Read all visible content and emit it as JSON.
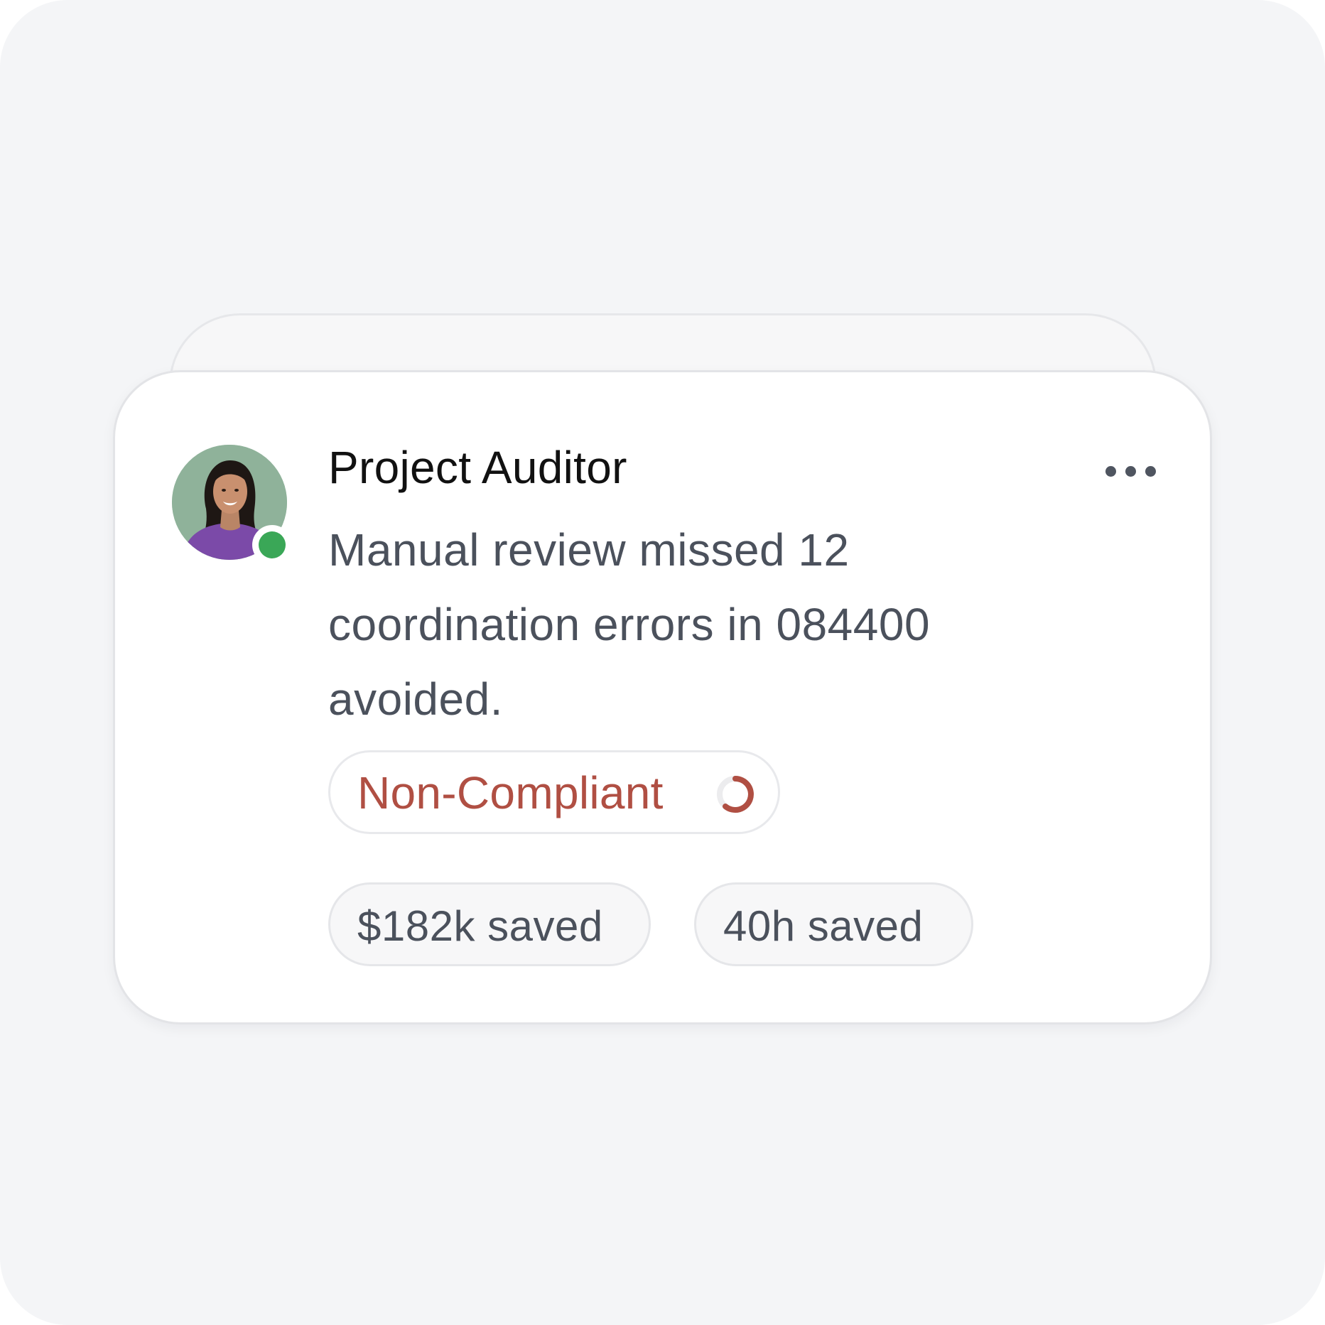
{
  "card": {
    "title": "Project Auditor",
    "message": "Manual review missed 12 coordination errors in 084400 avoided.",
    "avatar": {
      "alt": "avatar",
      "presence": "online"
    },
    "status": {
      "label": "Non-Compliant",
      "color": "#b04f43",
      "icon": "progress-ring-icon"
    },
    "metrics": [
      {
        "label": "$182k saved"
      },
      {
        "label": "40h saved"
      }
    ],
    "menu_icon": "more-horizontal-icon"
  },
  "colors": {
    "background": "#f4f5f7",
    "card": "#ffffff",
    "online": "#3aa757",
    "status_red": "#b04f43",
    "text_primary": "#111111",
    "text_secondary": "#4b515c"
  }
}
